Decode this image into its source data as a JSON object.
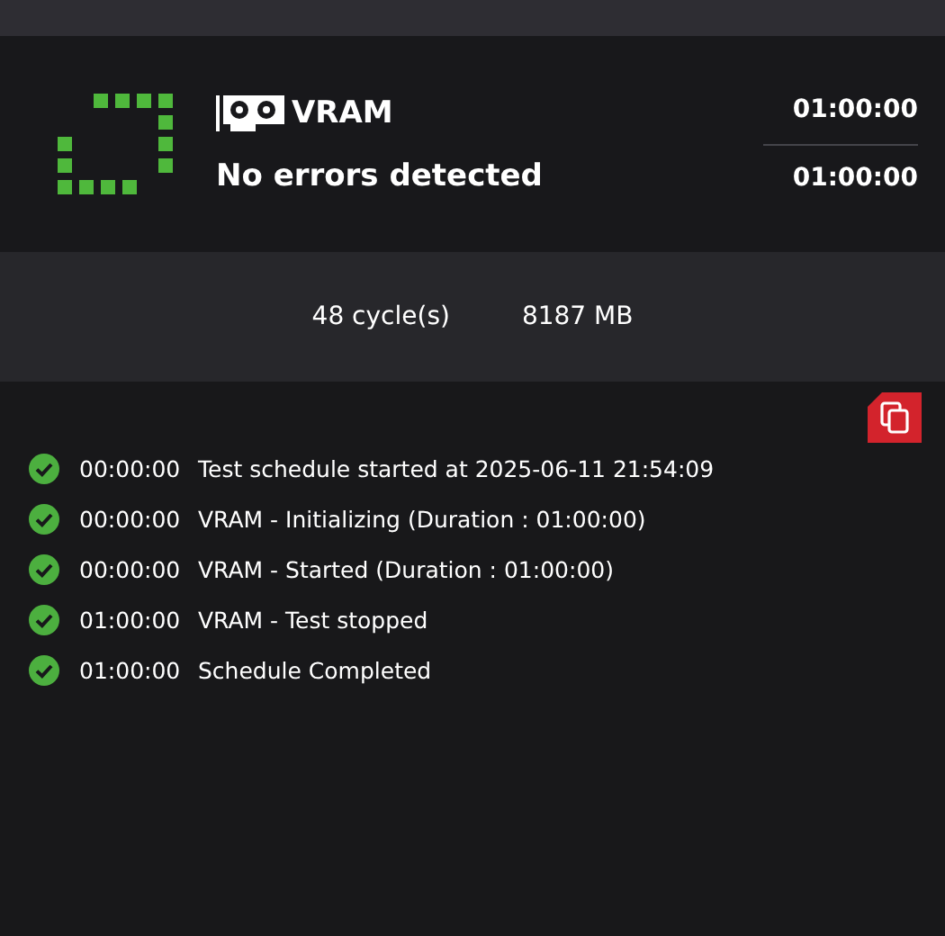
{
  "test": {
    "name": "VRAM",
    "result": "No errors detected",
    "elapsed": "01:00:00",
    "duration": "01:00:00"
  },
  "stats": {
    "cycles": "48 cycle(s)",
    "memory": "8187 MB"
  },
  "log": [
    {
      "passed": true,
      "time": "00:00:00",
      "message": "Test schedule started at 2025-06-11 21:54:09"
    },
    {
      "passed": true,
      "time": "00:00:00",
      "message": "VRAM - Initializing (Duration : 01:00:00)"
    },
    {
      "passed": true,
      "time": "00:00:00",
      "message": "VRAM - Started (Duration : 01:00:00)"
    },
    {
      "passed": true,
      "time": "01:00:00",
      "message": "VRAM - Test stopped"
    },
    {
      "passed": true,
      "time": "01:00:00",
      "message": "Schedule Completed"
    }
  ]
}
